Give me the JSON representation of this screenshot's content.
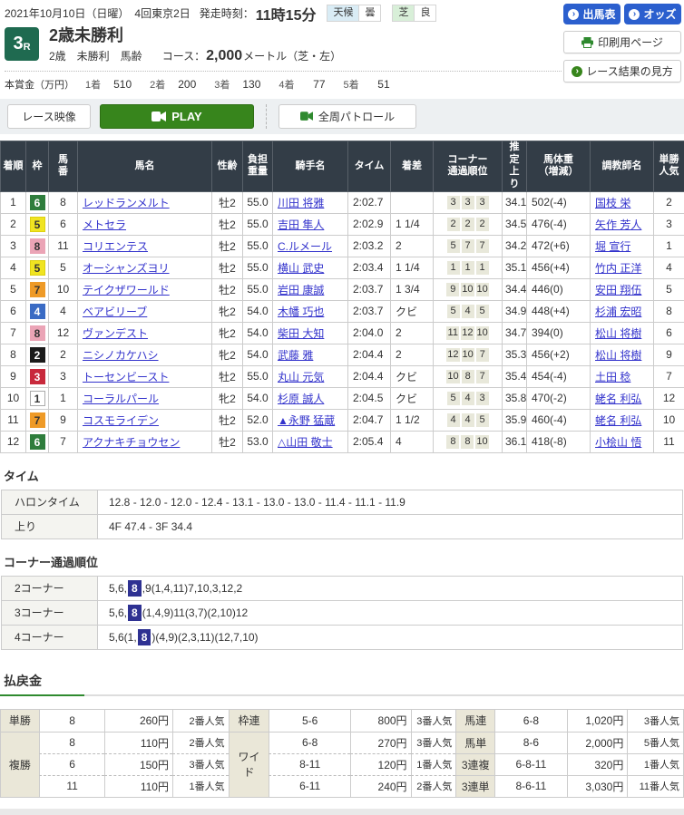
{
  "colors": {
    "button_blue": "#2b5fce",
    "play_green": "#37851c",
    "race_badge_green": "#1f6a50",
    "link_blue": "#3333cc",
    "table_header_bg": "#333d47",
    "corner_highlight_navy": "#2e3192",
    "payout_label_bg": "#eae7d8",
    "corner_box_bg": "#e8e8da",
    "weather_label_bg": "#d9ecf5",
    "turf_label_bg": "#d8efd8"
  },
  "frame_colors": {
    "1": {
      "bg": "#ffffff",
      "fg": "#333333",
      "border": "#aaaaaa"
    },
    "2": {
      "bg": "#1a1a1a",
      "fg": "#ffffff",
      "border": "#1a1a1a"
    },
    "3": {
      "bg": "#c8293c",
      "fg": "#ffffff",
      "border": "#c8293c"
    },
    "4": {
      "bg": "#3a6bc4",
      "fg": "#ffffff",
      "border": "#3a6bc4"
    },
    "5": {
      "bg": "#f0e421",
      "fg": "#333333",
      "border": "#ddd010"
    },
    "6": {
      "bg": "#2e7d3c",
      "fg": "#ffffff",
      "border": "#2e7d3c"
    },
    "7": {
      "bg": "#ee9a27",
      "fg": "#333333",
      "border": "#ee9a27"
    },
    "8": {
      "bg": "#eba4b6",
      "fg": "#333333",
      "border": "#eba4b6"
    }
  },
  "header": {
    "date": "2021年10月10日（日曜）　4回東京2日",
    "start_label": "発走時刻：",
    "start_time": "11時15分",
    "weather_label": "天候",
    "weather_value": "曇",
    "turf_label": "芝",
    "turf_value": "良",
    "entries_button": "出馬表",
    "odds_button": "オッズ",
    "print_button": "印刷用ページ",
    "guide_button": "レース結果の見方"
  },
  "race": {
    "number": "3",
    "number_suffix": "R",
    "title": "2歳未勝利",
    "conditions": "2歳　未勝利　馬齢",
    "course_label": "コース：",
    "course_distance": "2,000",
    "course_detail": "メートル（芝・左）"
  },
  "prize": {
    "label": "本賞金（万円）",
    "items": [
      {
        "rank": "1着",
        "amount": "510"
      },
      {
        "rank": "2着",
        "amount": "200"
      },
      {
        "rank": "3着",
        "amount": "130"
      },
      {
        "rank": "4着",
        "amount": "77"
      },
      {
        "rank": "5着",
        "amount": "51"
      }
    ]
  },
  "video": {
    "race_video_label": "レース映像",
    "play_label": "PLAY",
    "patrol_label": "全周パトロール"
  },
  "results": {
    "columns": [
      "着順",
      "枠",
      "馬\n番",
      "馬名",
      "性齢",
      "負担\n重量",
      "騎手名",
      "タイム",
      "着差",
      "コーナー\n通過順位",
      "推\n定\n上\nり",
      "馬体重\n（増減）",
      "調教師名",
      "単勝\n人気"
    ],
    "rows": [
      {
        "pos": "1",
        "frame": "6",
        "num": "8",
        "horse": "レッドランメルト",
        "sex_age": "牡2",
        "weight": "55.0",
        "jockey": "川田 将雅",
        "time": "2:02.7",
        "margin": "",
        "corners": [
          "3",
          "3",
          "3"
        ],
        "last3f": "34.1",
        "horse_weight": "502(-4)",
        "trainer": "国枝 栄",
        "popularity": "2"
      },
      {
        "pos": "2",
        "frame": "5",
        "num": "6",
        "horse": "メトセラ",
        "sex_age": "牡2",
        "weight": "55.0",
        "jockey": "吉田 隼人",
        "time": "2:02.9",
        "margin": "1 1/4",
        "corners": [
          "2",
          "2",
          "2"
        ],
        "last3f": "34.5",
        "horse_weight": "476(-4)",
        "trainer": "矢作 芳人",
        "popularity": "3"
      },
      {
        "pos": "3",
        "frame": "8",
        "num": "11",
        "horse": "コリエンテス",
        "sex_age": "牡2",
        "weight": "55.0",
        "jockey": "C.ルメール",
        "time": "2:03.2",
        "margin": "2",
        "corners": [
          "5",
          "7",
          "7"
        ],
        "last3f": "34.2",
        "horse_weight": "472(+6)",
        "trainer": "堀 宣行",
        "popularity": "1"
      },
      {
        "pos": "4",
        "frame": "5",
        "num": "5",
        "horse": "オーシャンズヨリ",
        "sex_age": "牡2",
        "weight": "55.0",
        "jockey": "横山 武史",
        "time": "2:03.4",
        "margin": "1 1/4",
        "corners": [
          "1",
          "1",
          "1"
        ],
        "last3f": "35.1",
        "horse_weight": "456(+4)",
        "trainer": "竹内 正洋",
        "popularity": "4"
      },
      {
        "pos": "5",
        "frame": "7",
        "num": "10",
        "horse": "テイクザワールド",
        "sex_age": "牡2",
        "weight": "55.0",
        "jockey": "岩田 康誠",
        "time": "2:03.7",
        "margin": "1 3/4",
        "corners": [
          "9",
          "10",
          "10"
        ],
        "last3f": "34.4",
        "horse_weight": "446(0)",
        "trainer": "安田 翔伍",
        "popularity": "5"
      },
      {
        "pos": "6",
        "frame": "4",
        "num": "4",
        "horse": "ベアビリーブ",
        "sex_age": "牝2",
        "weight": "54.0",
        "jockey": "木幡 巧也",
        "time": "2:03.7",
        "margin": "クビ",
        "corners": [
          "5",
          "4",
          "5"
        ],
        "last3f": "34.9",
        "horse_weight": "448(+4)",
        "trainer": "杉浦 宏昭",
        "popularity": "8"
      },
      {
        "pos": "7",
        "frame": "8",
        "num": "12",
        "horse": "ヴァンデスト",
        "sex_age": "牝2",
        "weight": "54.0",
        "jockey": "柴田 大知",
        "time": "2:04.0",
        "margin": "2",
        "corners": [
          "11",
          "12",
          "10"
        ],
        "last3f": "34.7",
        "horse_weight": "394(0)",
        "trainer": "松山 将樹",
        "popularity": "6"
      },
      {
        "pos": "8",
        "frame": "2",
        "num": "2",
        "horse": "ニシノカケハシ",
        "sex_age": "牝2",
        "weight": "54.0",
        "jockey": "武藤 雅",
        "time": "2:04.4",
        "margin": "2",
        "corners": [
          "12",
          "10",
          "7"
        ],
        "last3f": "35.3",
        "horse_weight": "456(+2)",
        "trainer": "松山 将樹",
        "popularity": "9"
      },
      {
        "pos": "9",
        "frame": "3",
        "num": "3",
        "horse": "トーセンビースト",
        "sex_age": "牡2",
        "weight": "55.0",
        "jockey": "丸山 元気",
        "time": "2:04.4",
        "margin": "クビ",
        "corners": [
          "10",
          "8",
          "7"
        ],
        "last3f": "35.4",
        "horse_weight": "454(-4)",
        "trainer": "土田 稔",
        "popularity": "7"
      },
      {
        "pos": "10",
        "frame": "1",
        "num": "1",
        "horse": "コーラルパール",
        "sex_age": "牝2",
        "weight": "54.0",
        "jockey": "杉原 誠人",
        "time": "2:04.5",
        "margin": "クビ",
        "corners": [
          "5",
          "4",
          "3"
        ],
        "last3f": "35.8",
        "horse_weight": "470(-2)",
        "trainer": "蛯名 利弘",
        "popularity": "12"
      },
      {
        "pos": "11",
        "frame": "7",
        "num": "9",
        "horse": "コスモライデン",
        "sex_age": "牡2",
        "weight": "52.0",
        "jockey": "▲永野 猛蔵",
        "time": "2:04.7",
        "margin": "1 1/2",
        "corners": [
          "4",
          "4",
          "5"
        ],
        "last3f": "35.9",
        "horse_weight": "460(-4)",
        "trainer": "蛯名 利弘",
        "popularity": "10"
      },
      {
        "pos": "12",
        "frame": "6",
        "num": "7",
        "horse": "アクナキチョウセン",
        "sex_age": "牡2",
        "weight": "53.0",
        "jockey": "△山田 敬士",
        "time": "2:05.4",
        "margin": "4",
        "corners": [
          "8",
          "8",
          "10"
        ],
        "last3f": "36.1",
        "horse_weight": "418(-8)",
        "trainer": "小桧山 悟",
        "popularity": "11"
      }
    ]
  },
  "time_section": {
    "title": "タイム",
    "rows": [
      {
        "label": "ハロンタイム",
        "value": "12.8 - 12.0 - 12.0 - 12.4 - 13.1 - 13.0 - 13.0 - 11.4 - 11.1 - 11.9"
      },
      {
        "label": "上り",
        "value": "4F 47.4 - 3F 34.4"
      }
    ]
  },
  "corner_section": {
    "title": "コーナー通過順位",
    "rows": [
      {
        "label": "2コーナー",
        "before": "5,6,",
        "highlight": "8",
        "after": ",9(1,4,11)7,10,3,12,2"
      },
      {
        "label": "3コーナー",
        "before": "5,6,",
        "highlight": "8",
        "after": "(1,4,9)11(3,7)(2,10)12"
      },
      {
        "label": "4コーナー",
        "before": "5,6(1,",
        "highlight": "8",
        "after": ")(4,9)(2,3,11)(12,7,10)"
      }
    ]
  },
  "payout": {
    "title": "払戻金",
    "groups": [
      {
        "rows": [
          {
            "type": "単勝",
            "cells": [
              {
                "sel": "8",
                "amount": "260円",
                "pop": "2番人気"
              }
            ]
          },
          {
            "type": "複勝",
            "cells": [
              {
                "sel": "8",
                "amount": "110円",
                "pop": "2番人気"
              },
              {
                "sel": "6",
                "amount": "150円",
                "pop": "3番人気"
              },
              {
                "sel": "11",
                "amount": "110円",
                "pop": "1番人気"
              }
            ]
          }
        ]
      },
      {
        "rows": [
          {
            "type": "枠連",
            "cells": [
              {
                "sel": "5-6",
                "amount": "800円",
                "pop": "3番人気"
              }
            ]
          },
          {
            "type": "ワイド",
            "cells": [
              {
                "sel": "6-8",
                "amount": "270円",
                "pop": "3番人気"
              },
              {
                "sel": "8-11",
                "amount": "120円",
                "pop": "1番人気"
              },
              {
                "sel": "6-11",
                "amount": "240円",
                "pop": "2番人気"
              }
            ]
          }
        ]
      },
      {
        "rows": [
          {
            "type": "馬連",
            "cells": [
              {
                "sel": "6-8",
                "amount": "1,020円",
                "pop": "3番人気"
              }
            ]
          },
          {
            "type": "馬単",
            "cells": [
              {
                "sel": "8-6",
                "amount": "2,000円",
                "pop": "5番人気"
              }
            ]
          },
          {
            "type": "3連複",
            "cells": [
              {
                "sel": "6-8-11",
                "amount": "320円",
                "pop": "1番人気"
              }
            ]
          },
          {
            "type": "3連単",
            "cells": [
              {
                "sel": "8-6-11",
                "amount": "3,030円",
                "pop": "11番人気"
              }
            ]
          }
        ]
      }
    ]
  }
}
